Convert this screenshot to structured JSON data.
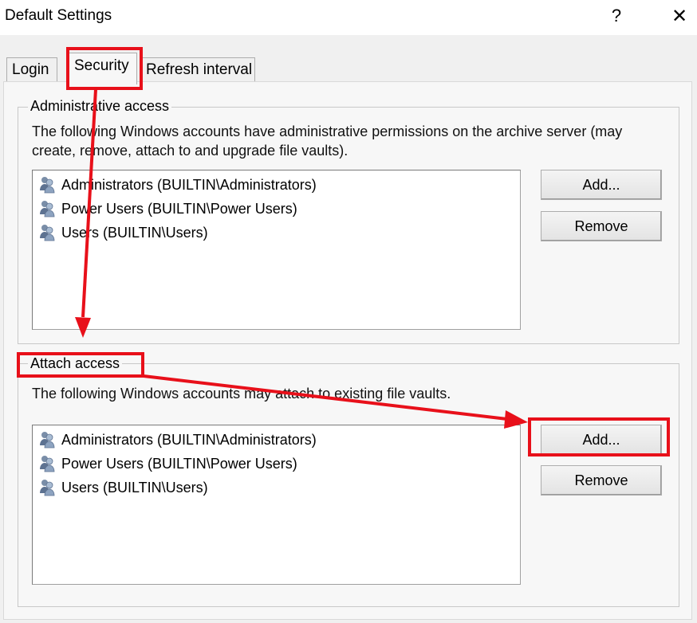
{
  "window": {
    "title": "Default Settings",
    "help_label": "?",
    "close_label": "✕"
  },
  "tabs": [
    {
      "label": "Login",
      "selected": false
    },
    {
      "label": "Security",
      "selected": true
    },
    {
      "label": "Refresh interval",
      "selected": false
    }
  ],
  "admin_group": {
    "legend": "Administrative access",
    "description": "The following Windows accounts have administrative permissions on the archive server (may create, remove, attach to and upgrade file vaults).",
    "accounts": [
      {
        "label": "Administrators (BUILTIN\\Administrators)",
        "icon": "users-icon"
      },
      {
        "label": "Power Users (BUILTIN\\Power Users)",
        "icon": "users-icon"
      },
      {
        "label": "Users (BUILTIN\\Users)",
        "icon": "users-icon"
      }
    ],
    "add_label": "Add...",
    "remove_label": "Remove"
  },
  "attach_group": {
    "legend": "Attach access",
    "description": "The following Windows accounts may attach to existing file vaults.",
    "accounts": [
      {
        "label": "Administrators (BUILTIN\\Administrators)",
        "icon": "users-icon"
      },
      {
        "label": "Power Users (BUILTIN\\Power Users)",
        "icon": "users-icon"
      },
      {
        "label": "Users (BUILTIN\\Users)",
        "icon": "users-icon"
      }
    ],
    "add_label": "Add...",
    "remove_label": "Remove"
  },
  "colors": {
    "annotation_red": "#e8101a",
    "dialog_bg": "#f0f0f0",
    "list_bg": "#ffffff"
  }
}
